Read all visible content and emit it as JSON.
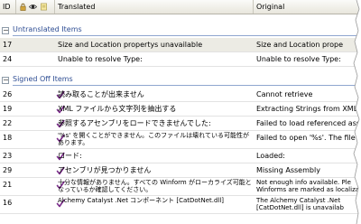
{
  "columns": {
    "id": "ID",
    "translated": "Translated",
    "original": "Original"
  },
  "sections": [
    {
      "title": "Untranslated Items",
      "toggle": "−",
      "rows": [
        {
          "id": "17",
          "translated": "Size and Location propertys unavailable",
          "original": "Size and Location prope",
          "selected": true
        },
        {
          "id": "24",
          "translated": "Unable to resolve Type:",
          "original": "Unable to resolve Type:"
        }
      ]
    },
    {
      "title": "Signed Off Items",
      "toggle": "−",
      "rows": [
        {
          "id": "26",
          "translated": "読み取ることが出来ません",
          "original": "Cannot retrieve"
        },
        {
          "id": "19",
          "translated": "XML ファイルから文字列を抽出する",
          "original": "Extracting Strings from XML F"
        },
        {
          "id": "22",
          "translated": "参照するアセンブリをロードできませんでした:",
          "original": "Failed to load referenced asse"
        },
        {
          "id": "18",
          "translated": "'%s' を開くことができません。このファイルは壊れている可能性があります。",
          "original": "Failed to open '%s'. The file r"
        },
        {
          "id": "23",
          "translated": "ロード:",
          "original": "Loaded:"
        },
        {
          "id": "29",
          "translated": "アセンブリが見つかりません",
          "original": "Missing Assembly"
        },
        {
          "id": "21",
          "translated": "十分な情報がありません。すべての Winform がローカライズ可能となっているか確認してください。",
          "original": "Not enough info available. Ple Winforms are marked as localiza"
        },
        {
          "id": "16",
          "translated": "Alchemy Catalyst .Net コンポーネント [CatDotNet.dll]",
          "original": "The Alchemy Catalyst .Net [CatDotNet.dll] is unavailab"
        }
      ]
    }
  ],
  "colors": {
    "section_title": "#2e4d93",
    "check": "#7a2a8a",
    "selected_row": "#ecebe4"
  }
}
